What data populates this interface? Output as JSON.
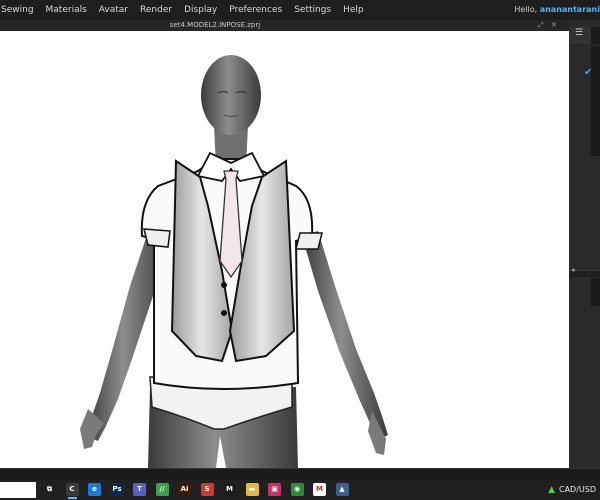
{
  "menu": {
    "items": [
      "Sewing",
      "Materials",
      "Avatar",
      "Render",
      "Display",
      "Preferences",
      "Settings",
      "Help"
    ],
    "greeting": "Hello,",
    "username": "ananantarani"
  },
  "window": {
    "title": "set4.MODEL2.INPOSE.zprj"
  },
  "icons": {
    "list": "list-icon",
    "checkmark": "check-icon",
    "expand": "expand-icon",
    "pin": "pin-icon",
    "collapse": "collapse-icon"
  },
  "taskbar": {
    "apps": [
      {
        "name": "task-view-icon",
        "glyph": "⧉",
        "color": "#202020"
      },
      {
        "name": "clo3d-app-icon",
        "glyph": "C",
        "color": "#3a3a3a"
      },
      {
        "name": "edge-browser-icon",
        "glyph": "e",
        "color": "#1f7ad4"
      },
      {
        "name": "photoshop-app-icon",
        "glyph": "Ps",
        "color": "#0a2b4f"
      },
      {
        "name": "teams-app-icon",
        "glyph": "T",
        "color": "#5b5fc7"
      },
      {
        "name": "green-app-icon",
        "glyph": "//",
        "color": "#3aa14a"
      },
      {
        "name": "illustrator-app-icon",
        "glyph": "Ai",
        "color": "#3a1a04"
      },
      {
        "name": "red-app-icon",
        "glyph": "S",
        "color": "#d33a2c"
      },
      {
        "name": "m-app-icon",
        "glyph": "M",
        "color": "#1b1b1b"
      },
      {
        "name": "folder-app-icon",
        "glyph": "▬",
        "color": "#e6b84a"
      },
      {
        "name": "pink-app-icon",
        "glyph": "▣",
        "color": "#c2356b"
      },
      {
        "name": "chrome-browser-icon",
        "glyph": "◉",
        "color": "#2f8b3a"
      },
      {
        "name": "gmail-app-icon",
        "glyph": "M",
        "color": "#ffffff"
      },
      {
        "name": "photos-app-icon",
        "glyph": "▲",
        "color": "#3d5f8a"
      }
    ],
    "currency": "CAD/USD"
  }
}
